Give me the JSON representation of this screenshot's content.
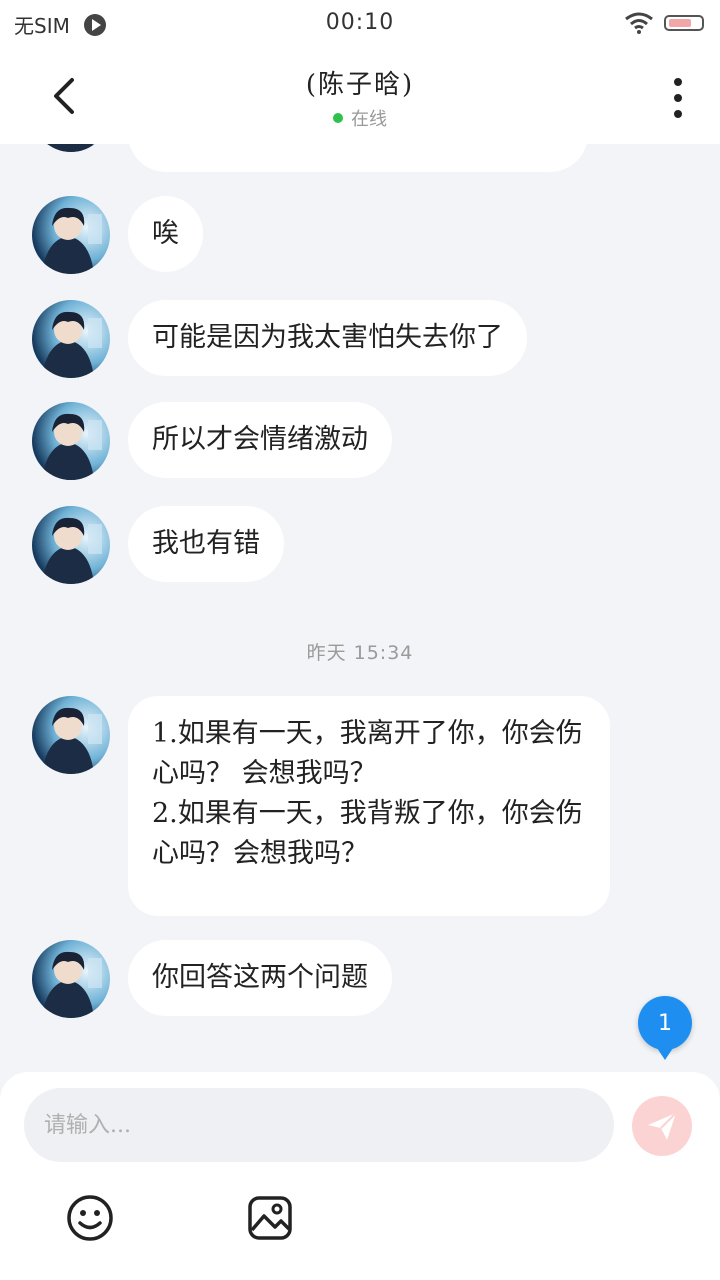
{
  "status_bar": {
    "carrier": "无SIM",
    "time": "00:10"
  },
  "header": {
    "title": "(陈子晗)",
    "status": "在线"
  },
  "messages": [
    {
      "text": ""
    },
    {
      "text": "唉"
    },
    {
      "text": "可能是因为我太害怕失去你了"
    },
    {
      "text": "所以才会情绪激动"
    },
    {
      "text": "我也有错"
    },
    {
      "text": "1.如果有一天，我离开了你，你会伤心吗？ 会想我吗？\n2.如果有一天，我背叛了你，你会伤心吗？会想我吗？"
    },
    {
      "text": "你回答这两个问题"
    }
  ],
  "timestamp": "昨天 15:34",
  "unread_badge": "1",
  "composer": {
    "placeholder": "请输入..."
  },
  "colors": {
    "accent_blue": "#1e8ff0",
    "online_green": "#2ec24a",
    "send_disabled": "#fbd3d3"
  }
}
